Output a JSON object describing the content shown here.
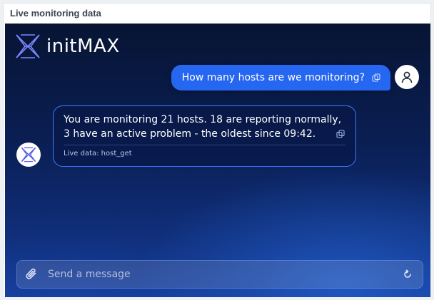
{
  "widget": {
    "title": "Live monitoring data"
  },
  "brand": {
    "name": "initMAX"
  },
  "messages": {
    "user": {
      "text": "How many hosts are we monitoring?"
    },
    "assistant": {
      "text": "You are monitoring 21 hosts. 18 are reporting normally, 3 have an active problem - the oldest since 09:42.",
      "source": "Live data: host_get"
    }
  },
  "composer": {
    "placeholder": "Send a message"
  },
  "colors": {
    "accent": "#2667f2",
    "bubble_border": "#3e7bff",
    "background_top": "#071433",
    "background_bottom": "#143a94"
  },
  "icons": {
    "brand": "initmax-logo-icon",
    "copy": "copy-icon",
    "user": "user-icon",
    "attach": "paperclip-icon",
    "reload": "reload-icon"
  }
}
